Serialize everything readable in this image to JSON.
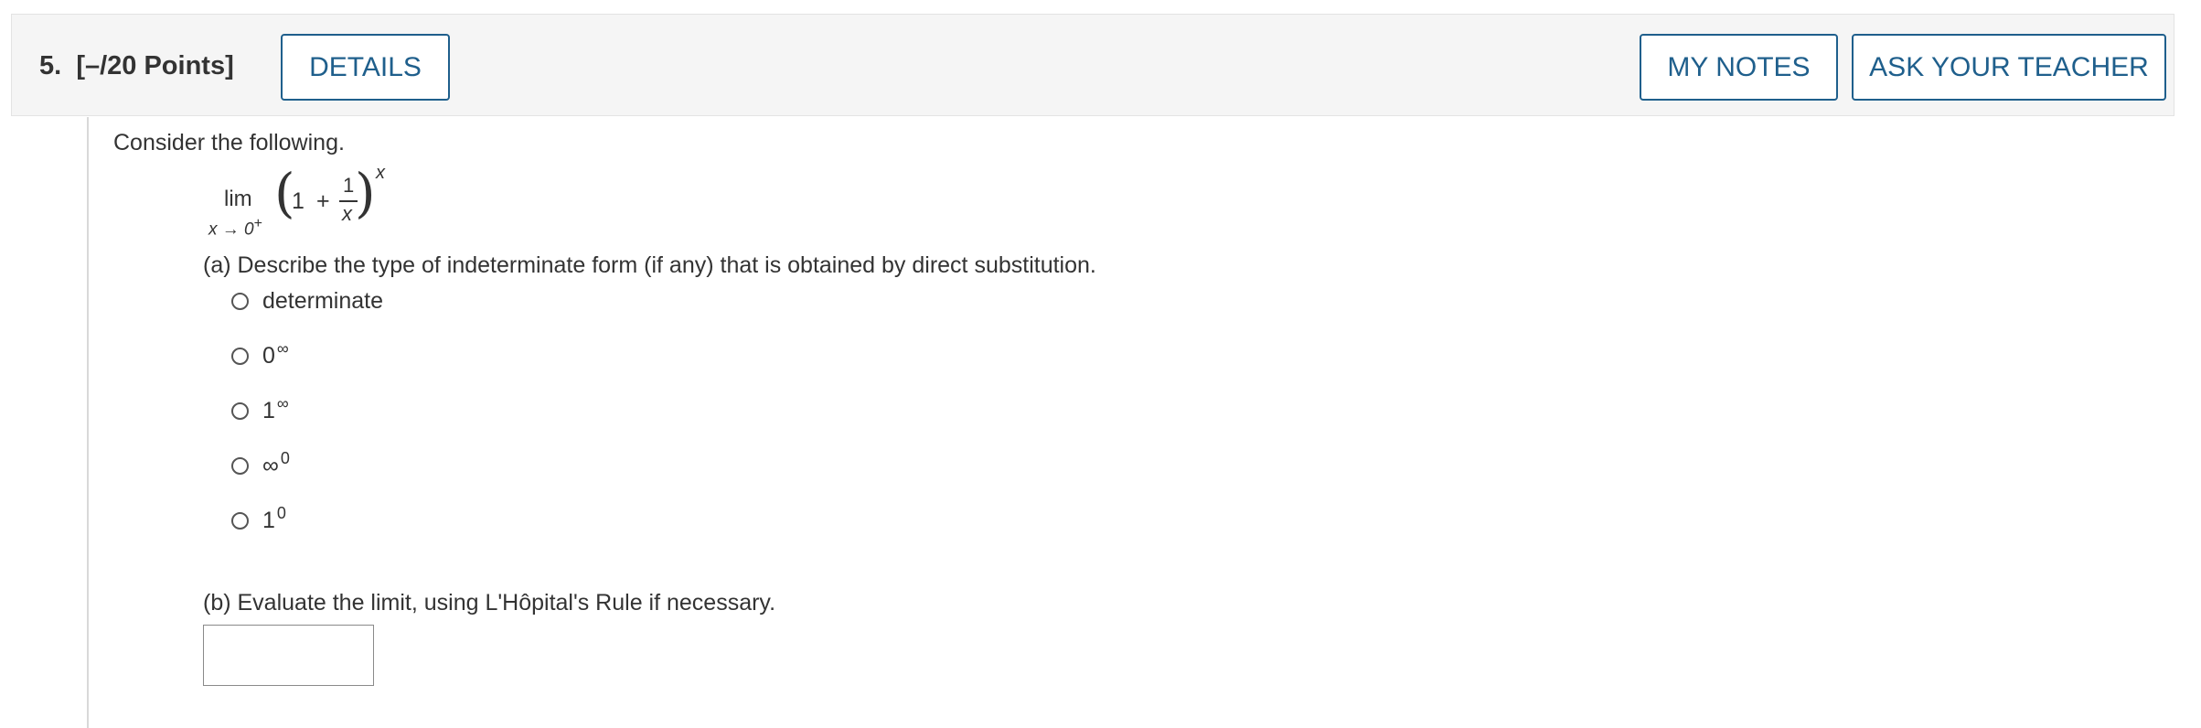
{
  "question": {
    "number": "5.",
    "points": "[–/20 Points]"
  },
  "header": {
    "details_label": "DETAILS",
    "my_notes_label": "MY NOTES",
    "ask_teacher_label": "ASK YOUR TEACHER"
  },
  "colors": {
    "accent": "#1f5f8c",
    "header_bg": "#f5f5f5",
    "text": "#333333"
  },
  "intro_text": "Consider the following.",
  "expression": {
    "lim": "lim",
    "approach": "x → 0",
    "approach_side": "+",
    "one": "1",
    "plus": "+",
    "numerator": "1",
    "denominator": "x",
    "exponent": "x",
    "paren_left": "(",
    "paren_right": ")"
  },
  "part_a": {
    "prompt": "(a) Describe the type of indeterminate form (if any) that is obtained by direct substitution.",
    "options": [
      {
        "base": "determinate",
        "sup": ""
      },
      {
        "base": "0",
        "sup": "∞"
      },
      {
        "base": "1",
        "sup": "∞"
      },
      {
        "base": "∞",
        "sup": "0"
      },
      {
        "base": "1",
        "sup": "0"
      }
    ],
    "selected": null
  },
  "part_b": {
    "prompt": "(b) Evaluate the limit, using L'Hôpital's Rule if necessary.",
    "answer_value": ""
  }
}
